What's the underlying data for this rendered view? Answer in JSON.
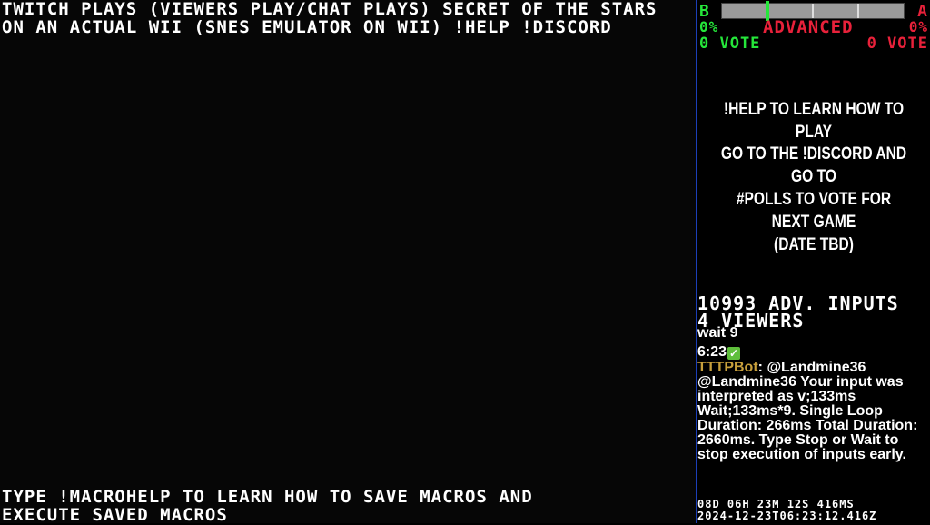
{
  "stream": {
    "title_line1": "TWITCH PLAYS (VIEWERS PLAY/CHAT PLAYS) SECRET OF THE STARS",
    "title_line2": "ON AN ACTUAL WII (SNES EMULATOR ON WII) !HELP !DISCORD",
    "macro_line1": "TYPE !MACROHELP TO LEARN HOW TO SAVE MACROS AND",
    "macro_line2": "EXECUTE SAVED MACROS"
  },
  "vote": {
    "left_letter": "B",
    "right_letter": "A",
    "left_pct": "0%",
    "right_pct": "0%",
    "mode": "ADVANCED",
    "left_votes": "0 VOTE",
    "right_votes": "0 VOTE",
    "bar_marker_fraction": 0.25,
    "colors": {
      "left": "#25e63a",
      "right": "#e8213a"
    }
  },
  "info": {
    "help": "!HELP TO LEARN HOW TO PLAY",
    "discord_line1": "GO TO THE !DISCORD AND GO TO",
    "discord_line2": "#POLLS TO VOTE FOR NEXT GAME",
    "discord_line3": "(DATE TBD)"
  },
  "stats": {
    "adv_inputs": "10993 ADV. INPUTS",
    "viewers": "4 VIEWERS"
  },
  "chat": {
    "prev_line": "wait 9",
    "time": "6:23",
    "user": "TTTPBot",
    "message": "@Landmine36 @Landmine36 Your input was interpreted as v;133ms Wait;133ms*9. Single Loop Duration: 266ms Total Duration: 2660ms. Type Stop or Wait to stop execution of inputs early."
  },
  "footer": {
    "uptime": "08D 06H 23M 12S 416MS",
    "timestamp": "2024-12-23T06:23:12.416Z"
  }
}
